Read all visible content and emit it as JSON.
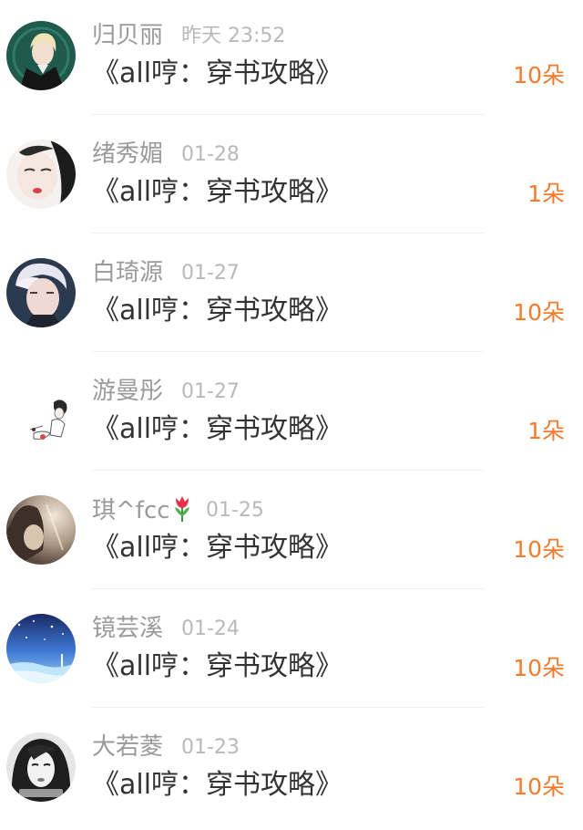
{
  "colors": {
    "name": "#9a9a9a",
    "time": "#b9b9b9",
    "book": "#333333",
    "count": "#f47a2c",
    "divider": "#efefef"
  },
  "items": [
    {
      "name": "归贝丽",
      "time": "昨天 23:52",
      "book": "《all哼：穿书攻略》",
      "count": "10朵",
      "avatar_icon": "anime-blond-man-avatar"
    },
    {
      "name": "绪秀媚",
      "time": "01-28",
      "book": "《all哼：穿书攻略》",
      "count": "1朵",
      "avatar_icon": "girl-closed-eyes-avatar"
    },
    {
      "name": "白琦源",
      "time": "01-27",
      "book": "《all哼：穿书攻略》",
      "count": "10朵",
      "avatar_icon": "white-hair-boy-avatar"
    },
    {
      "name": "游曼彤",
      "time": "01-27",
      "book": "《all哼：穿书攻略》",
      "count": "1朵",
      "avatar_icon": "sketch-girl-avatar"
    },
    {
      "name": "琪^fcc",
      "name_emoji": "tulip-icon",
      "time": "01-25",
      "book": "《all哼：穿书攻略》",
      "count": "10朵",
      "avatar_icon": "sepia-girl-avatar"
    },
    {
      "name": "镜芸溪",
      "time": "01-24",
      "book": "《all哼：穿书攻略》",
      "count": "10朵",
      "avatar_icon": "night-sky-avatar"
    },
    {
      "name": "大若菱",
      "time": "01-23",
      "book": "《all哼：穿书攻略》",
      "count": "10朵",
      "avatar_icon": "bw-girl-portrait-avatar"
    }
  ]
}
